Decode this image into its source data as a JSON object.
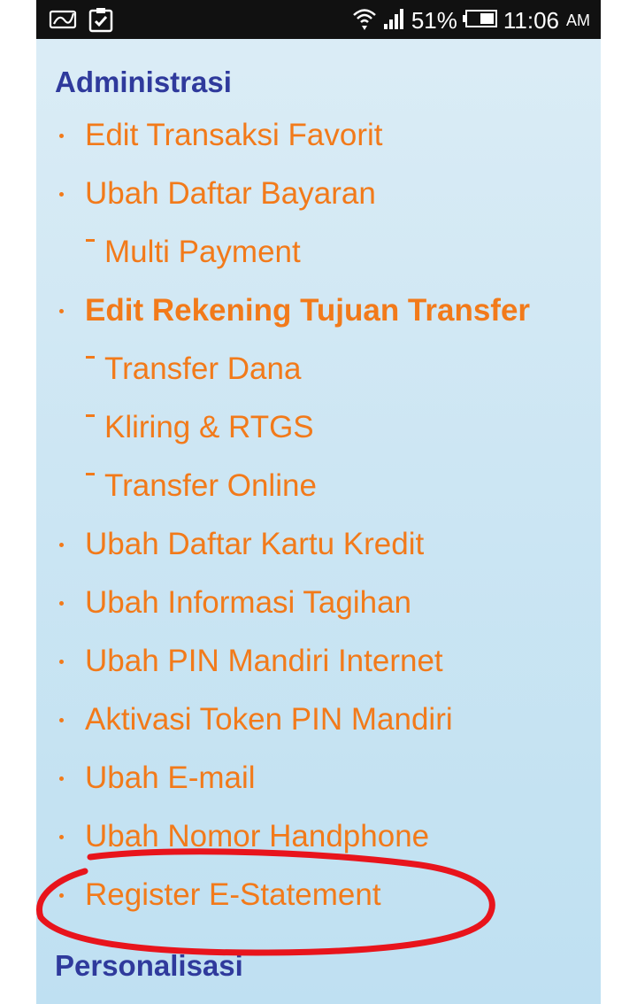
{
  "status_bar": {
    "battery_percent": "51%",
    "time": "11:06",
    "ampm": "AM",
    "icons": [
      "signature-icon",
      "clipboard-check-icon",
      "wifi-icon",
      "signal-icon",
      "battery-icon"
    ]
  },
  "sections": {
    "administrasi": "Administrasi",
    "personalisasi": "Personalisasi"
  },
  "menu": {
    "items": [
      {
        "label": "Edit Transaksi Favorit",
        "level": 1
      },
      {
        "label": "Ubah Daftar Bayaran",
        "level": 1
      },
      {
        "label": "Multi Payment",
        "level": 2
      },
      {
        "label": "Edit Rekening Tujuan Transfer",
        "level": 1,
        "bold": true
      },
      {
        "label": "Transfer Dana",
        "level": 2
      },
      {
        "label": "Kliring & RTGS",
        "level": 2
      },
      {
        "label": "Transfer Online",
        "level": 2
      },
      {
        "label": "Ubah Daftar Kartu Kredit",
        "level": 1
      },
      {
        "label": "Ubah Informasi Tagihan",
        "level": 1
      },
      {
        "label": "Ubah PIN Mandiri Internet",
        "level": 1
      },
      {
        "label": "Aktivasi Token PIN Mandiri",
        "level": 1
      },
      {
        "label": "Ubah E-mail",
        "level": 1
      },
      {
        "label": "Ubah Nomor Handphone",
        "level": 1
      },
      {
        "label": "Register E-Statement",
        "level": 1
      }
    ]
  },
  "colors": {
    "link_orange": "#f27a1a",
    "heading_blue": "#2f3a9c",
    "annotation_red": "#e8141c"
  }
}
